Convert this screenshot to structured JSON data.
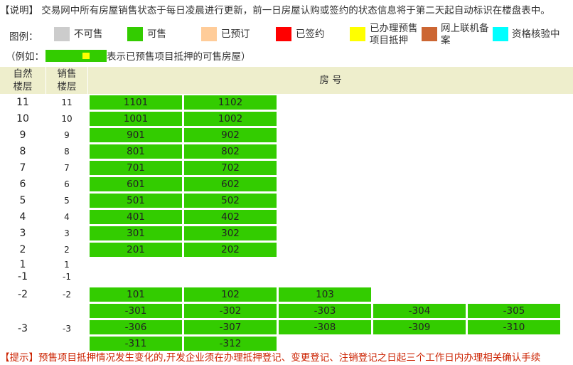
{
  "note": {
    "bracket": "【说明】",
    "text": "交易网中所有房屋销售状态于每日凌晨进行更新，前一日房屋认购或签约的状态信息将于第二天起自动标识在楼盘表中。"
  },
  "legend": {
    "label": "图例：",
    "items": [
      {
        "label": "不可售",
        "color": "#cccccc"
      },
      {
        "label": "可售",
        "color": "#33cc00"
      },
      {
        "label": "已预订",
        "color": "#ffcc99"
      },
      {
        "label": "已签约",
        "color": "#ff0000"
      },
      {
        "label_line1": "已办理预售",
        "label_line2": "项目抵押",
        "color": "#ffff00"
      },
      {
        "label_line1": "网上联机备",
        "label_line2": "案",
        "color": "#cc6633"
      },
      {
        "label": "资格核验中",
        "color": "#00ffff"
      }
    ]
  },
  "example": {
    "prefix": "（例如：",
    "suffix": "表示已预售项目抵押的可售房屋）"
  },
  "header": {
    "natural_floor_line1": "自然",
    "natural_floor_line2": "楼层",
    "sale_floor_line1": "销售",
    "sale_floor_line2": "楼层",
    "room_number": "房 号"
  },
  "floors": [
    {
      "natural": "11",
      "sale": "11",
      "units": [
        "1101",
        "1102"
      ]
    },
    {
      "natural": "10",
      "sale": "10",
      "units": [
        "1001",
        "1002"
      ]
    },
    {
      "natural": "9",
      "sale": "9",
      "units": [
        "901",
        "902"
      ]
    },
    {
      "natural": "8",
      "sale": "8",
      "units": [
        "801",
        "802"
      ]
    },
    {
      "natural": "7",
      "sale": "7",
      "units": [
        "701",
        "702"
      ]
    },
    {
      "natural": "6",
      "sale": "6",
      "units": [
        "601",
        "602"
      ]
    },
    {
      "natural": "5",
      "sale": "5",
      "units": [
        "501",
        "502"
      ]
    },
    {
      "natural": "4",
      "sale": "4",
      "units": [
        "401",
        "402"
      ]
    },
    {
      "natural": "3",
      "sale": "3",
      "units": [
        "301",
        "302"
      ]
    },
    {
      "natural": "2",
      "sale": "2",
      "units": [
        "201",
        "202"
      ]
    },
    {
      "natural": "1",
      "sale": "1",
      "units": []
    },
    {
      "natural": "-1",
      "sale": "-1",
      "units": []
    },
    {
      "natural": "-2",
      "sale": "-2",
      "units": [
        "101",
        "102",
        "103"
      ]
    },
    {
      "natural": "-3",
      "sale": "-3",
      "rows": [
        [
          "-301",
          "-302",
          "-303",
          "-304",
          "-305"
        ],
        [
          "-306",
          "-307",
          "-308",
          "-309",
          "-310"
        ],
        [
          "-311",
          "-312"
        ]
      ]
    }
  ],
  "tip": {
    "text": "【提示】预售项目抵押情况发生变化的,开发企业须在办理抵押登记、变更登记、注销登记之日起三个工作日内办理相关确认手续"
  }
}
